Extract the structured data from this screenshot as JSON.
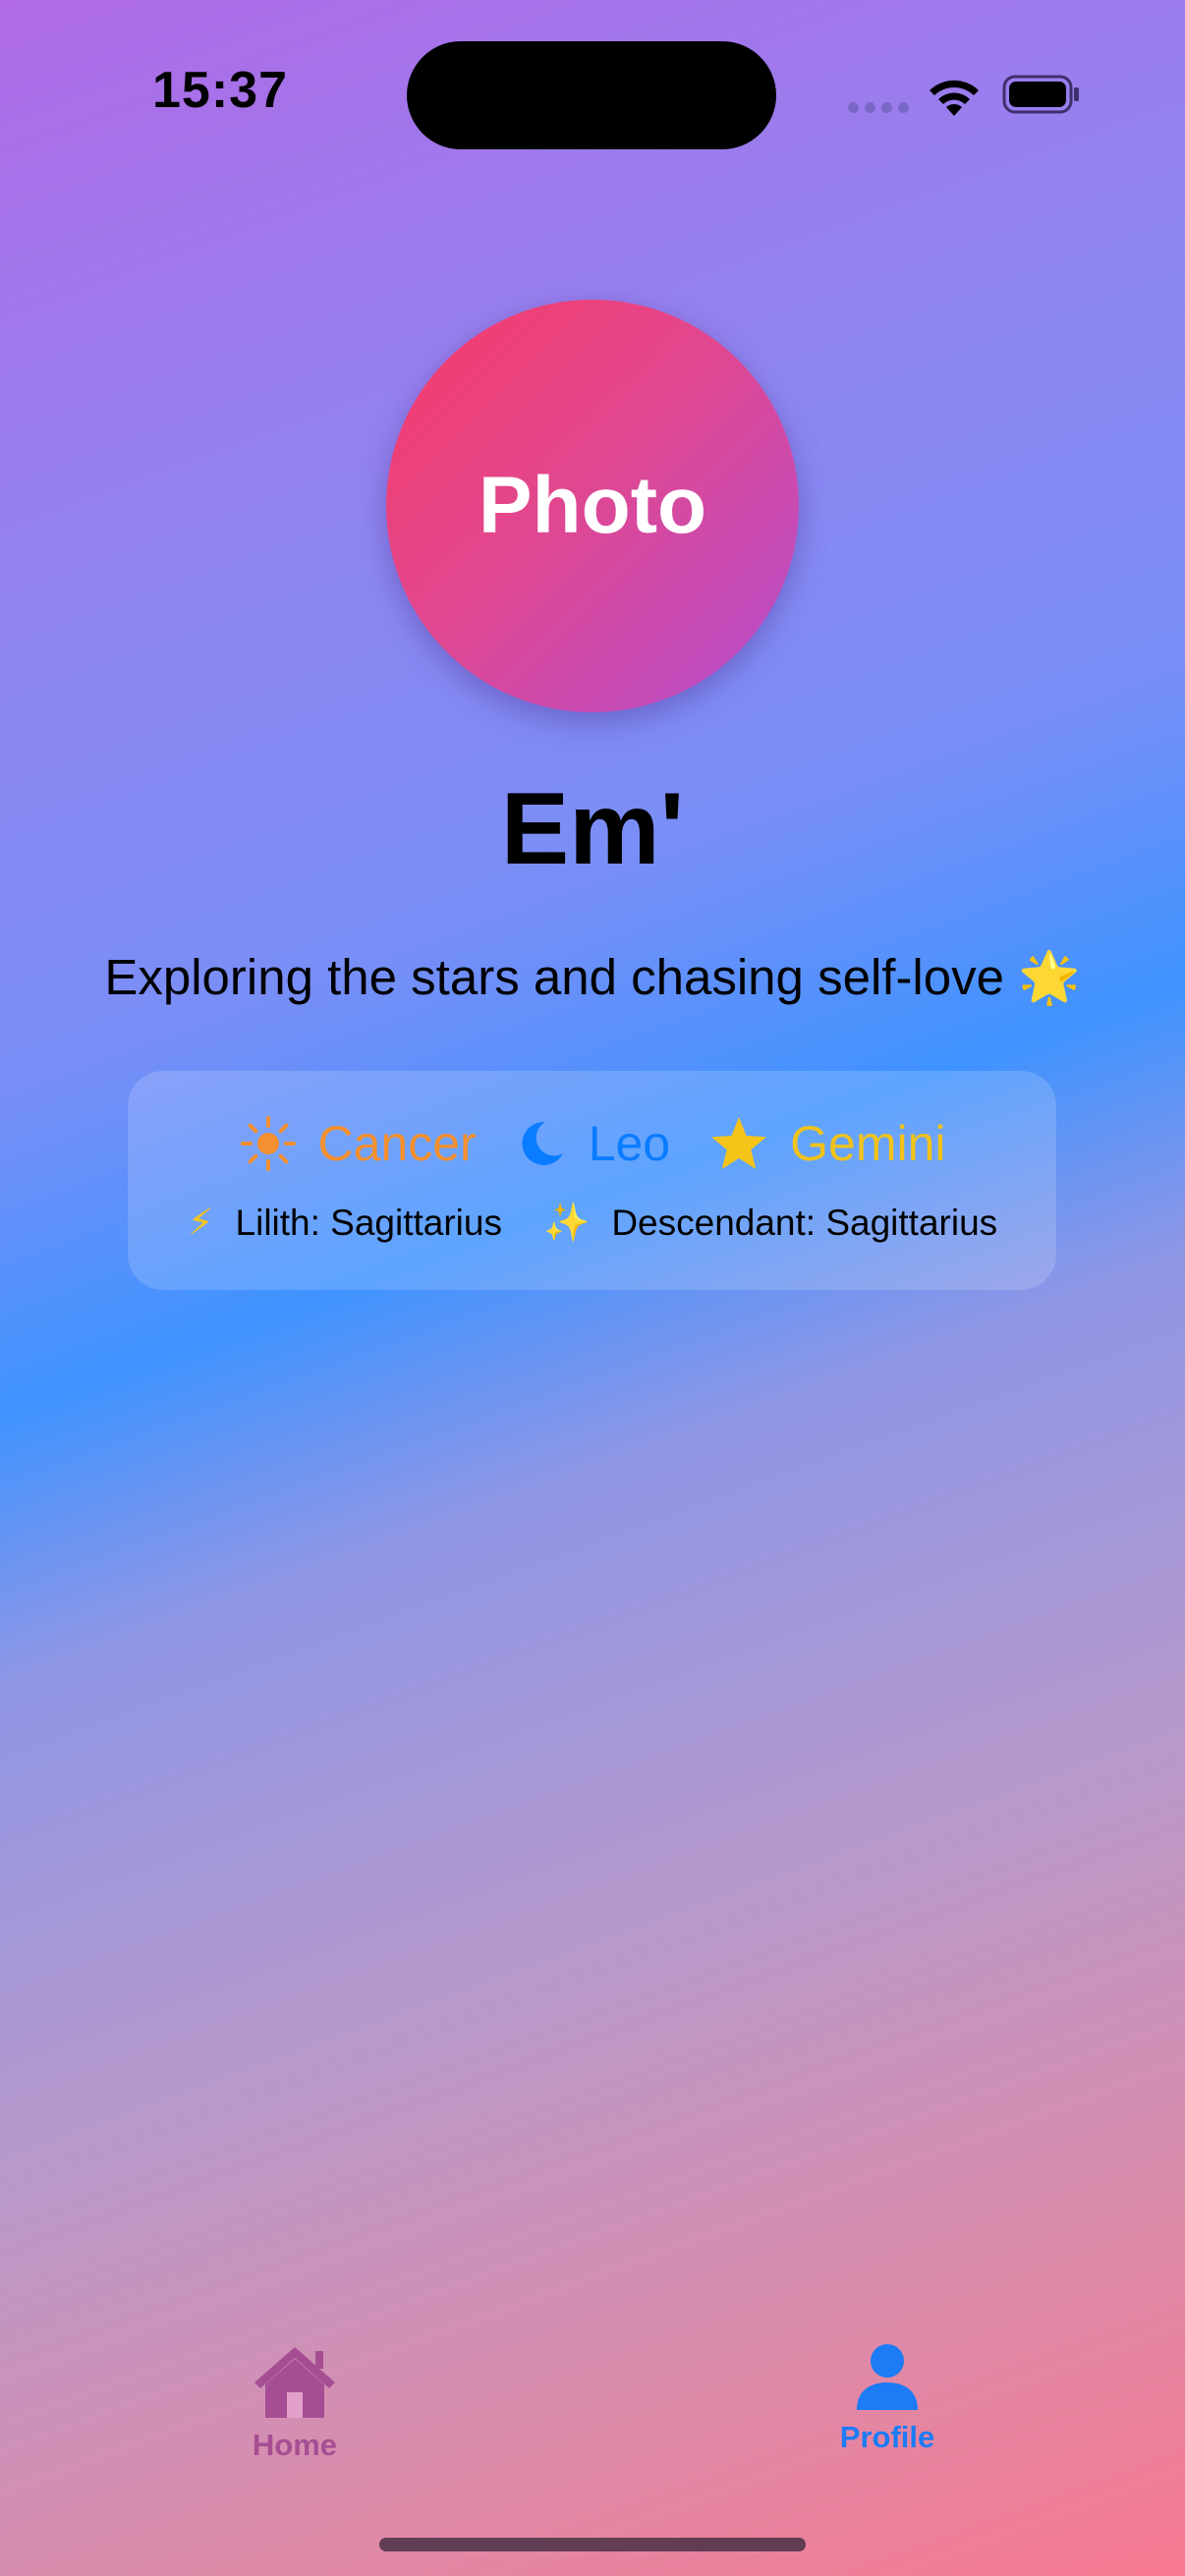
{
  "status_bar": {
    "time": "15:37"
  },
  "profile": {
    "photo_label": "Photo",
    "name": "Em'",
    "bio": "Exploring the stars and chasing self-love 🌟"
  },
  "signs": {
    "sun": {
      "icon": "sun-icon",
      "label": "Cancer",
      "color": "#f4902f"
    },
    "moon": {
      "icon": "moon-icon",
      "label": "Leo",
      "color": "#0a7cff"
    },
    "rising": {
      "icon": "star-icon",
      "label": "Gemini",
      "color": "#f0c21c"
    },
    "lilith": {
      "icon": "lightning-icon",
      "label": "Lilith: Sagittarius"
    },
    "descendant": {
      "icon": "sparkles-icon",
      "label": "Descendant: Sagittarius"
    }
  },
  "tab_bar": {
    "tabs": [
      {
        "label": "Home",
        "icon": "house-icon",
        "color": "#a64e93",
        "selected": false
      },
      {
        "label": "Profile",
        "icon": "person-icon",
        "color": "#1c7bf5",
        "selected": true
      }
    ]
  }
}
